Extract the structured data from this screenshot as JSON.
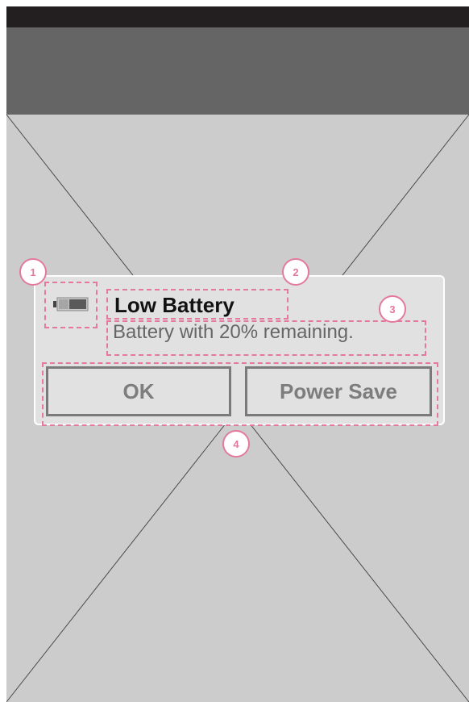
{
  "dialog": {
    "title": "Low Battery",
    "message": "Battery with 20% remaining.",
    "buttons": {
      "ok": "OK",
      "power_save": "Power Save"
    },
    "icon": "battery-icon",
    "battery_level": 0.2
  },
  "annotations": {
    "labels": [
      "1",
      "2",
      "3",
      "4"
    ]
  },
  "colors": {
    "status_bar": "#231f20",
    "action_bar": "#656565",
    "background": "#cccccc",
    "dialog_bg": "#e1e1e1",
    "annotation": "#e3799f"
  }
}
